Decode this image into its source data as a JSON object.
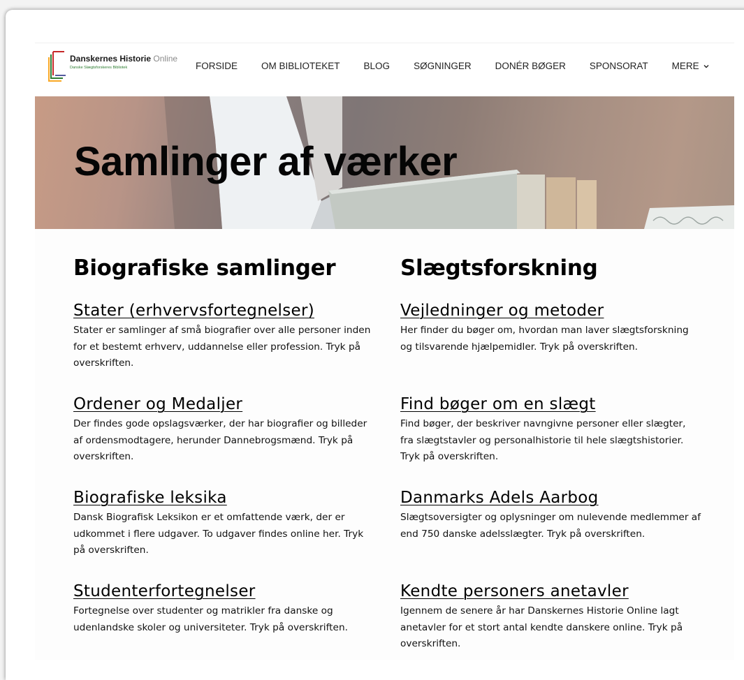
{
  "logo": {
    "title": "Danskernes Historie",
    "title_suffix": "Online",
    "subtitle": "Danske Slægtsforskeres Bibliotek"
  },
  "nav": [
    {
      "label": "FORSIDE"
    },
    {
      "label": "OM BIBLIOTEKET"
    },
    {
      "label": "BLOG"
    },
    {
      "label": "SØGNINGER"
    },
    {
      "label": "DONÉR BØGER"
    },
    {
      "label": "SPONSORAT"
    },
    {
      "label": "MERE"
    }
  ],
  "hero": {
    "title": "Samlinger af værker"
  },
  "columns": [
    {
      "heading": "Biografiske samlinger",
      "items": [
        {
          "title": "Stater (erhvervsfortegnelser)",
          "text": "Stater er samlinger af små biografier over alle personer inden for et bestemt erhverv, uddannelse eller profession. Tryk på overskriften."
        },
        {
          "title": "Ordener og Medaljer",
          "text": "Der findes gode opslagsværker, der har biografier og billeder af ordensmodtagere, herunder Dannebrogsmænd. Tryk på overskriften."
        },
        {
          "title": "Biografiske leksika",
          "text": "Dansk Biografisk Leksikon er et omfattende værk, der er udkommet i flere udgaver. To udgaver findes online her. Tryk på overskriften."
        },
        {
          "title": "Studenterfortegnelser",
          "text": "Fortegnelse over studenter og matrikler fra danske og udenlandske skoler og universiteter. Tryk på overskriften."
        }
      ]
    },
    {
      "heading": "Slægtsforskning",
      "items": [
        {
          "title": "Vejledninger og metoder",
          "text": "Her finder du bøger om, hvordan man laver slægtsforskning og tilsvarende hjælpemidler. Tryk på overskriften."
        },
        {
          "title": "Find bøger om en slægt",
          "text": "Find bøger, der beskriver navngivne personer eller slægter, fra slægtstavler og personalhistorie til hele slægtshistorier. Tryk på overskriften."
        },
        {
          "title": "Danmarks Adels Aarbog",
          "text": "Slægtsoversigter og oplysninger om nulevende medlemmer af end 750 danske adelsslægter. Tryk på overskriften."
        },
        {
          "title": "Kendte personers anetavler",
          "text": "Igennem de senere år har Danskernes Historie Online lagt anetavler for et stort antal kendte danskere online. Tryk på overskriften."
        }
      ]
    }
  ]
}
